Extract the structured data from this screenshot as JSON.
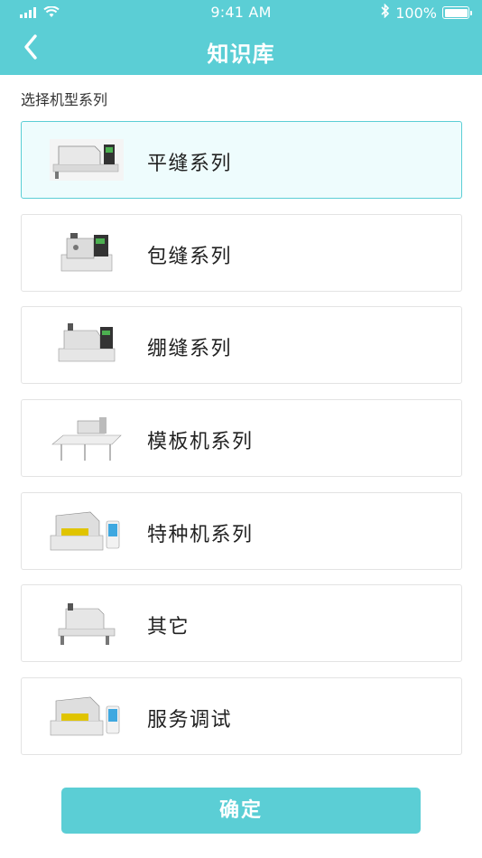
{
  "status_bar": {
    "time": "9:41 AM",
    "battery_text": "100%",
    "icons": [
      "signal-icon",
      "wifi-icon",
      "bluetooth-icon",
      "battery-icon"
    ]
  },
  "nav": {
    "title": "知识库",
    "back_icon": "chevron-left-icon"
  },
  "section_label": "选择机型系列",
  "items": [
    {
      "label": "平缝系列",
      "icon": "lockstitch-machine-icon",
      "selected": true
    },
    {
      "label": "包缝系列",
      "icon": "overlock-machine-icon",
      "selected": false
    },
    {
      "label": "绷缝系列",
      "icon": "coverstitch-machine-icon",
      "selected": false
    },
    {
      "label": "模板机系列",
      "icon": "template-machine-icon",
      "selected": false
    },
    {
      "label": "特种机系列",
      "icon": "special-machine-icon",
      "selected": false
    },
    {
      "label": "其它",
      "icon": "other-machine-icon",
      "selected": false
    },
    {
      "label": "服务调试",
      "icon": "service-machine-icon",
      "selected": false
    }
  ],
  "confirm_label": "确定",
  "colors": {
    "accent": "#5bced5",
    "selected_bg": "#eefcfd",
    "card_border": "#e3e3e3"
  }
}
